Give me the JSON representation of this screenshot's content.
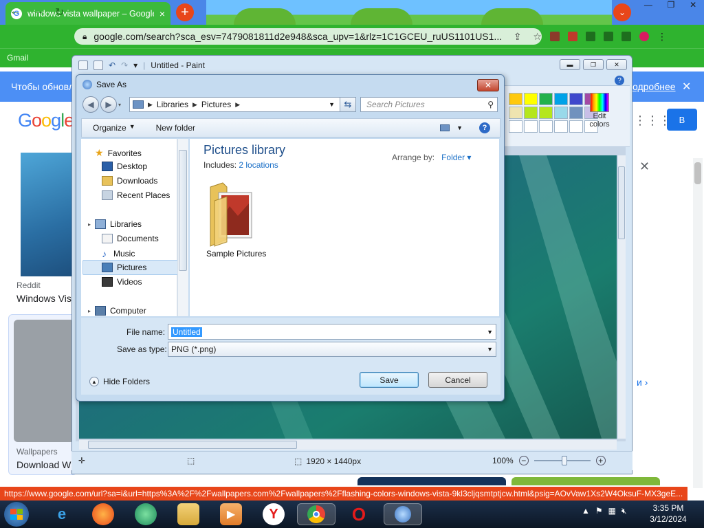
{
  "browser": {
    "tab_title": "windows vista wallpaper – Google",
    "tab_close": "×",
    "new_tab": "+",
    "tab_menu": "⌄",
    "url": "google.com/search?sca_esv=7479081811d2e948&sca_upv=1&rlz=1C1GCEU_ruUS1101US1...",
    "bookmark_gmail": "Gmail",
    "window_controls": [
      "—",
      "❐",
      "✕"
    ]
  },
  "google": {
    "info_text": "Чтобы обновл",
    "info_more": "одробнее",
    "info_close": "✕",
    "logo": "Google",
    "reddit_source": "Reddit",
    "result_title": "Windows Vis",
    "wallpapers_source": "Wallpapers",
    "download_title": "Download W",
    "right_button": "В",
    "more_chevron": "›",
    "close_overlay": "✕",
    "bullet": "и"
  },
  "paint": {
    "title": "Untitled - Paint",
    "edit_colors": [
      "Edit",
      "colors"
    ],
    "dimensions": "1920 × 1440px",
    "zoom": "100%",
    "zoom_out": "−",
    "zoom_in": "+",
    "palette": [
      "#ffc90e",
      "#ffff00",
      "#22b14c",
      "#00a2e8",
      "#3f48cc",
      "#a349a4",
      "#efe4b0",
      "#b5e61d",
      "#b5e61d",
      "#99d9ea",
      "#7092be",
      "#c8bfe7",
      "#ffffff",
      "#ffffff",
      "#ffffff",
      "#ffffff",
      "#ffffff",
      "#ffffff"
    ]
  },
  "dialog": {
    "title": "Save As",
    "breadcrumb": [
      "Libraries",
      "Pictures"
    ],
    "search_placeholder": "Search Pictures",
    "organize": "Organize",
    "new_folder": "New folder",
    "nav": {
      "favorites": "Favorites",
      "desktop": "Desktop",
      "downloads": "Downloads",
      "recent": "Recent Places",
      "libraries": "Libraries",
      "documents": "Documents",
      "music": "Music",
      "pictures": "Pictures",
      "videos": "Videos",
      "computer": "Computer"
    },
    "library_title": "Pictures library",
    "includes_label": "Includes:",
    "includes_link": "2 locations",
    "arrange_label": "Arrange by:",
    "arrange_value": "Folder",
    "folder_name": "Sample Pictures",
    "file_name_label": "File name:",
    "file_name_value": "Untitled",
    "save_type_label": "Save as type:",
    "save_type_value": "PNG (*.png)",
    "hide_folders": "Hide Folders",
    "save": "Save",
    "cancel": "Cancel"
  },
  "status_url": "https://www.google.com/url?sa=i&url=https%3A%2F%2Fwallpapers.com%2Fwallpapers%2Fflashing-colors-windows-vista-9kl3cljqsmtptjcw.html&psig=AOvVaw1Xs2W4OksuF-MX3geE...",
  "taskbar": {
    "time": "3:35 PM",
    "date": "3/12/2024"
  }
}
